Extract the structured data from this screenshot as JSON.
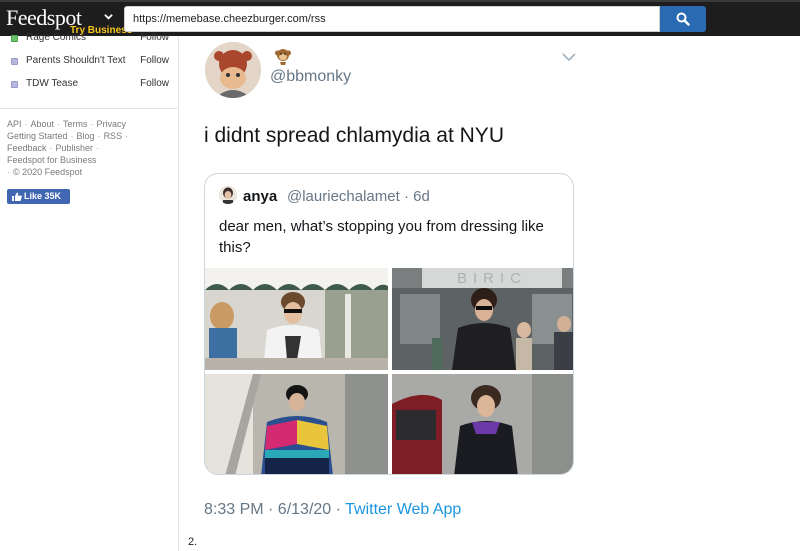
{
  "header": {
    "brand": "Feedspot",
    "brand_sub": "Try Business",
    "url": "https://memebase.cheezburger.com/rss"
  },
  "sidebar": {
    "feeds": [
      {
        "name": "Rage Comics",
        "action": "Follow"
      },
      {
        "name": "Parents Shouldn't Text",
        "action": "Follow"
      },
      {
        "name": "TDW Tease",
        "action": "Follow"
      }
    ],
    "footer_links": {
      "api": "API",
      "about": "About",
      "terms": "Terms",
      "privacy": "Privacy",
      "getting_started": "Getting Started",
      "blog": "Blog",
      "rss": "RSS",
      "feedback": "Feedback",
      "publisher": "Publisher",
      "business": "Feedspot for Business",
      "copyright": "© 2020 Feedspot"
    },
    "like_button": "Like 35K"
  },
  "tweet": {
    "handle": "@bbmonky",
    "text": "i didnt spread chlamydia at NYU",
    "quote": {
      "name": "anya",
      "handle": "@lauriechalamet · 6d",
      "text": "dear men, what’s stopping you from dressing like this?",
      "storefront_sign": "BIRIC"
    },
    "time": "8:33 PM · 6/13/20 · ",
    "source": "Twitter Web App"
  },
  "item_number": "2.",
  "colors": {
    "topbar": "#1d1d1d",
    "search_button": "#2a6ab3",
    "link_blue": "#1b95e0",
    "muted_text": "#657786",
    "like_blue": "#4267b2"
  },
  "icons": {
    "search": "search-icon",
    "caret": "chevron-down-icon",
    "like": "thumbs-up-icon",
    "emoji": "monkey-emoji-icon"
  }
}
